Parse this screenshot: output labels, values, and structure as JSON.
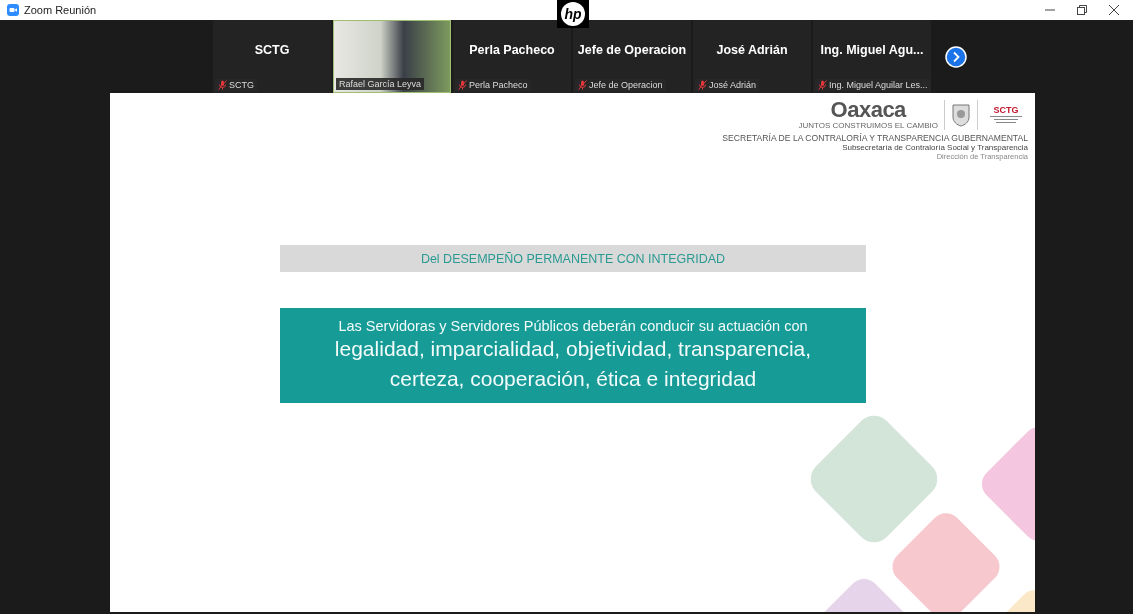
{
  "window": {
    "title": "Zoom Reunión",
    "logo": "hp"
  },
  "participants": [
    {
      "kind": "name",
      "name": "SCTG",
      "label": "SCTG",
      "muted": true
    },
    {
      "kind": "video",
      "label": "Rafael García Leyva",
      "muted": false
    },
    {
      "kind": "name",
      "name": "Perla Pacheco",
      "label": "Perla Pacheco",
      "muted": true
    },
    {
      "kind": "name",
      "name": "Jefe de Operacion",
      "label": "Jefe de Operacion",
      "muted": true
    },
    {
      "kind": "name",
      "name": "José Adrián",
      "label": "José Adrián",
      "muted": true
    },
    {
      "kind": "name",
      "name": "Ing. Miguel Agu...",
      "label": "Ing. Miguel Aguilar Les...",
      "muted": true
    }
  ],
  "slide": {
    "logo": "Oaxaca",
    "tagline": "JUNTOS CONSTRUIMOS EL CAMBIO",
    "badge": "SCTG",
    "org": "SECRETARÍA DE LA CONTRALORÍA Y TRANSPARENCIA GUBERNAMENTAL",
    "suborg": "Subsecretaría de Contraloría Social y Transparencia",
    "office": "Dirección de Transparencia",
    "heading": "Del DESEMPEÑO PERMANENTE CON INTEGRIDAD",
    "lead": "Las Servidoras y Servidores Públicos deberán conducir su actuación con",
    "values": [
      "legalidad, imparcialidad, objetividad, transparencia,",
      "certeza, cooperación, ética e integridad"
    ]
  }
}
